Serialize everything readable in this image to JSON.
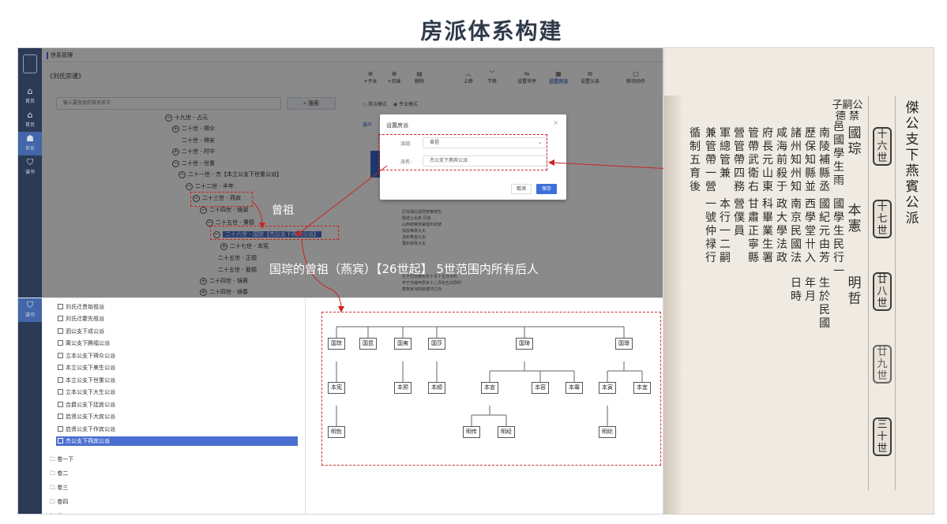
{
  "title": "房派体系构建",
  "app": {
    "breadcrumb": "世系管理",
    "book_title": "《刘氏宗谱》",
    "rail": [
      {
        "label": "首页",
        "icon": "home-icon"
      },
      {
        "label": "首页",
        "icon": "home-icon"
      },
      {
        "label": "世系",
        "icon": "users-icon"
      },
      {
        "label": "谱书",
        "icon": "shield-icon"
      }
    ],
    "lower_rail_label": "谱书",
    "search": {
      "placeholder": "输入要查找的族员名字",
      "button": "搜索"
    },
    "tree": [
      {
        "text": "十九世 - 占元",
        "toggle": "⊖"
      },
      {
        "text": "二十世 - 得众",
        "toggle": "⊕"
      },
      {
        "text": "二十世 - 得安",
        "toggle": ""
      },
      {
        "text": "二十世 - 时中",
        "toggle": "⊕"
      },
      {
        "text": "二十世 - 世重",
        "toggle": "⊖"
      },
      {
        "text": "二十一世 - 杰【本立公支下世重公派】",
        "toggle": "⊖"
      },
      {
        "text": "二十二世 - 丰年",
        "toggle": "⊖"
      },
      {
        "text": "二十三世 - 燕宾",
        "toggle": "⊖"
      },
      {
        "text": "二十四世 - 镜湖",
        "toggle": "⊖"
      },
      {
        "text": "二十五世 - 秉德",
        "toggle": "⊖"
      },
      {
        "text": "二十六世 - 国琮【杰公支下燕宾公派】",
        "toggle": "⊖"
      },
      {
        "text": "二十七世 - 本宪",
        "toggle": "⊕"
      },
      {
        "text": "二十五世 - 正德",
        "toggle": ""
      },
      {
        "text": "二十五世 - 懿德",
        "toggle": ""
      },
      {
        "text": "二十四世 - 镜蓉",
        "toggle": "⊕"
      },
      {
        "text": "二十四世 - 镜春",
        "toggle": "⊕"
      }
    ],
    "toolbar": [
      {
        "label": "+子女",
        "icon": "⊕"
      },
      {
        "label": "+兄妹",
        "icon": "⊕"
      },
      {
        "label": "删除",
        "icon": "▤"
      },
      {
        "label": "上移",
        "icon": "︿"
      },
      {
        "label": "下移",
        "icon": "﹀"
      },
      {
        "label": "设置世序",
        "icon": "⇋"
      },
      {
        "label": "设置房派",
        "icon": "▦"
      },
      {
        "label": "设置父亲",
        "icon": "⧉"
      },
      {
        "label": "移动动作",
        "icon": "▢"
      }
    ],
    "modes": {
      "simple": "简洁模式",
      "pro": "专业模式"
    },
    "tab": "循环",
    "detail_lines": [
      "历任湖北提刑按察使司",
      "赐进士出身 历官",
      "山西按察使署理布政使",
      "加授奉政大夫",
      "诰封奉直大夫",
      "晋封资政大夫",
      "生于同治癸亥年十月十五日午时",
      "卒于光绪甲辰年十二月初五日辰时",
      "葬朱家河四房塘冲乙向"
    ],
    "dialog": {
      "title": "设置房派",
      "close": "×",
      "field1_label": "派组:",
      "field1_value": "曾祖",
      "field2_label": "派名:",
      "field2_value": "杰公支下燕宾公派",
      "cancel": "取消",
      "save": "保存"
    },
    "branch_list": [
      "刘氏迁贵始祖派",
      "刘氏迁霍先祖派",
      "泗公支下成公派",
      "寓公支下腾福公派",
      "立本公支下得众公派",
      "本立公支下美生公派",
      "本立公支下世重公派",
      "立本公支下大生公派",
      "合爵公支下廷宾公派",
      "启贤公支下大宾公派",
      "启贤公支下作宾公派",
      "杰公支下燕宾公派"
    ],
    "volumes": [
      "卷一下",
      "卷二",
      "卷三",
      "卷四",
      "卷五"
    ]
  },
  "family_tree": {
    "generation_26": [
      "国琮",
      "国昆",
      "国夷",
      "国莎",
      "国琦",
      "国璟"
    ],
    "generation_27": [
      "本宪",
      "本预",
      "本顺",
      "本宣",
      "本容",
      "本骞",
      "本寅",
      "本宜"
    ],
    "generation_28": [
      "明哲",
      "明传",
      "明经",
      "明纶"
    ]
  },
  "annotations": {
    "great_grandfather": "曾祖",
    "scope": "国琮的曾祖（燕宾）【26世起】 5世范围内所有后人"
  },
  "scan": {
    "header": "子嗣公德 禁",
    "branch_label": "傑公支下燕賓公派",
    "generation_badges": [
      "十六世",
      "十七世",
      "廿八世",
      "廿九世",
      "三十世"
    ],
    "columns": [
      "國琮",
      "本憲",
      "明哲",
      "邑國學生雨",
      "國學生民行一",
      "南陵補縣丞",
      "國紀元由芳",
      "生於民國",
      "歷保知縣並",
      "西學堂卄入",
      "年月",
      "諸州知州知",
      "南京民國法",
      "日時",
      "咸海前殺于",
      "政大學法政",
      "府長元山東",
      "科畢業生署",
      "管帶武衛右",
      "甘肅正寧縣",
      "營管帶四務",
      "營僕員",
      "軍總管兼",
      "本行一二嗣",
      "兼管帶一營",
      "一號仲禄行",
      "循制五育後"
    ]
  }
}
